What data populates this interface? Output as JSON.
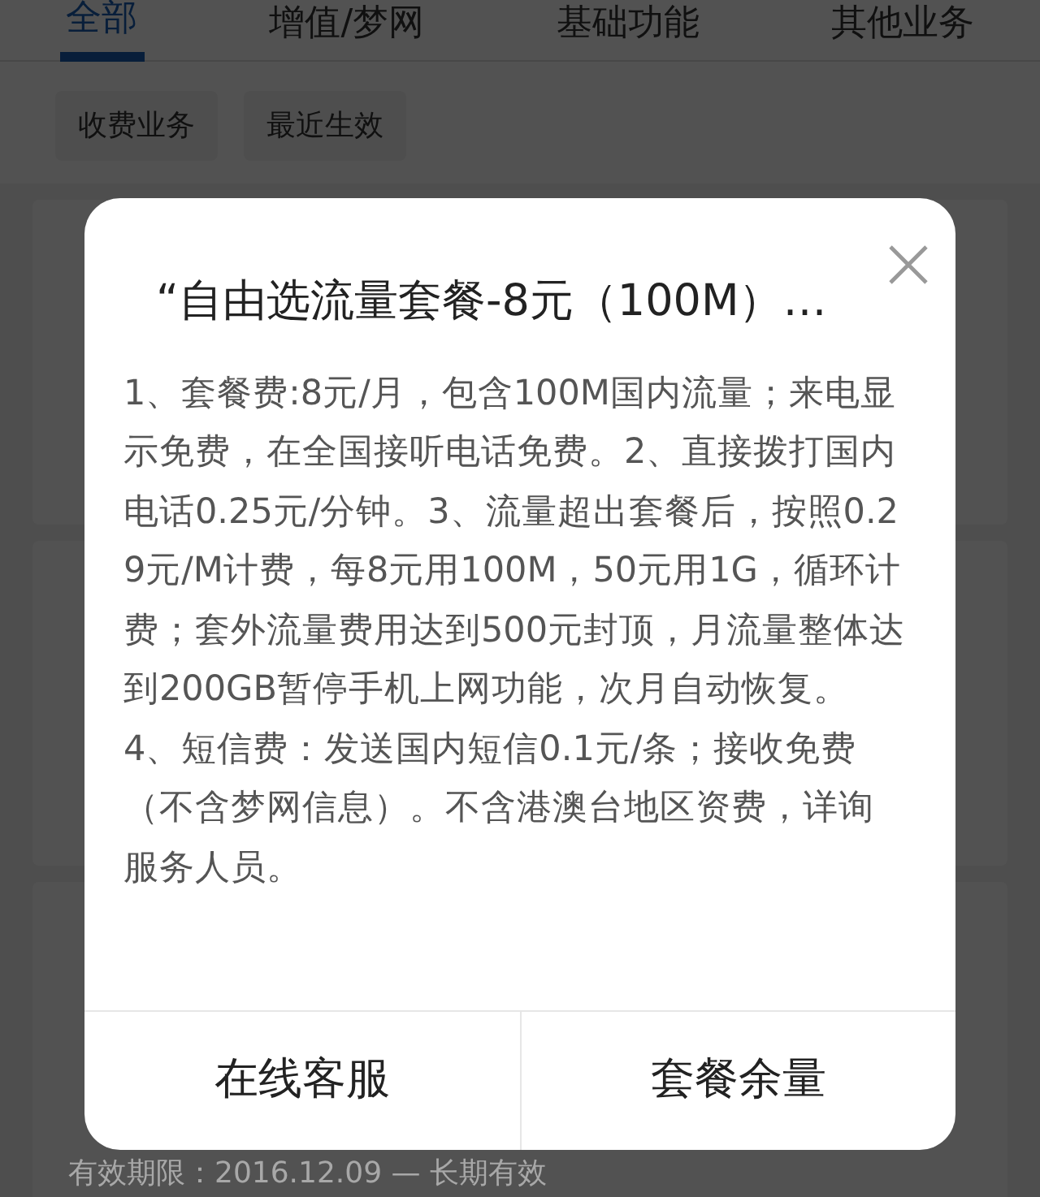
{
  "tabs": [
    {
      "label": "全部",
      "selected": true
    },
    {
      "label": "增值/梦网",
      "selected": false
    },
    {
      "label": "基础功能",
      "selected": false
    },
    {
      "label": "其他业务",
      "selected": false
    }
  ],
  "filters": [
    "收费业务",
    "最近生效"
  ],
  "validity": "有效期限：2016.12.09 — 长期有效",
  "dialog": {
    "title": "“自由选流量套餐-8元（100M）…",
    "body": "1、套餐费:8元/月，包含100M国内流量；来电显示免费，在全国接听电话免费。2、直接拨打国内电话0.25元/分钟。3、流量超出套餐后，按照0.29元/M计费，每8元用100M，50元用1G，循环计费；套外流量费用达到500元封顶，月流量整体达到200GB暂停手机上网功能，次月自动恢复。4、短信费：发送国内短信0.1元/条；接收免费（不含梦网信息）。不含港澳台地区资费，详询服务人员。",
    "buttons": [
      "在线客服",
      "套餐余量"
    ]
  }
}
